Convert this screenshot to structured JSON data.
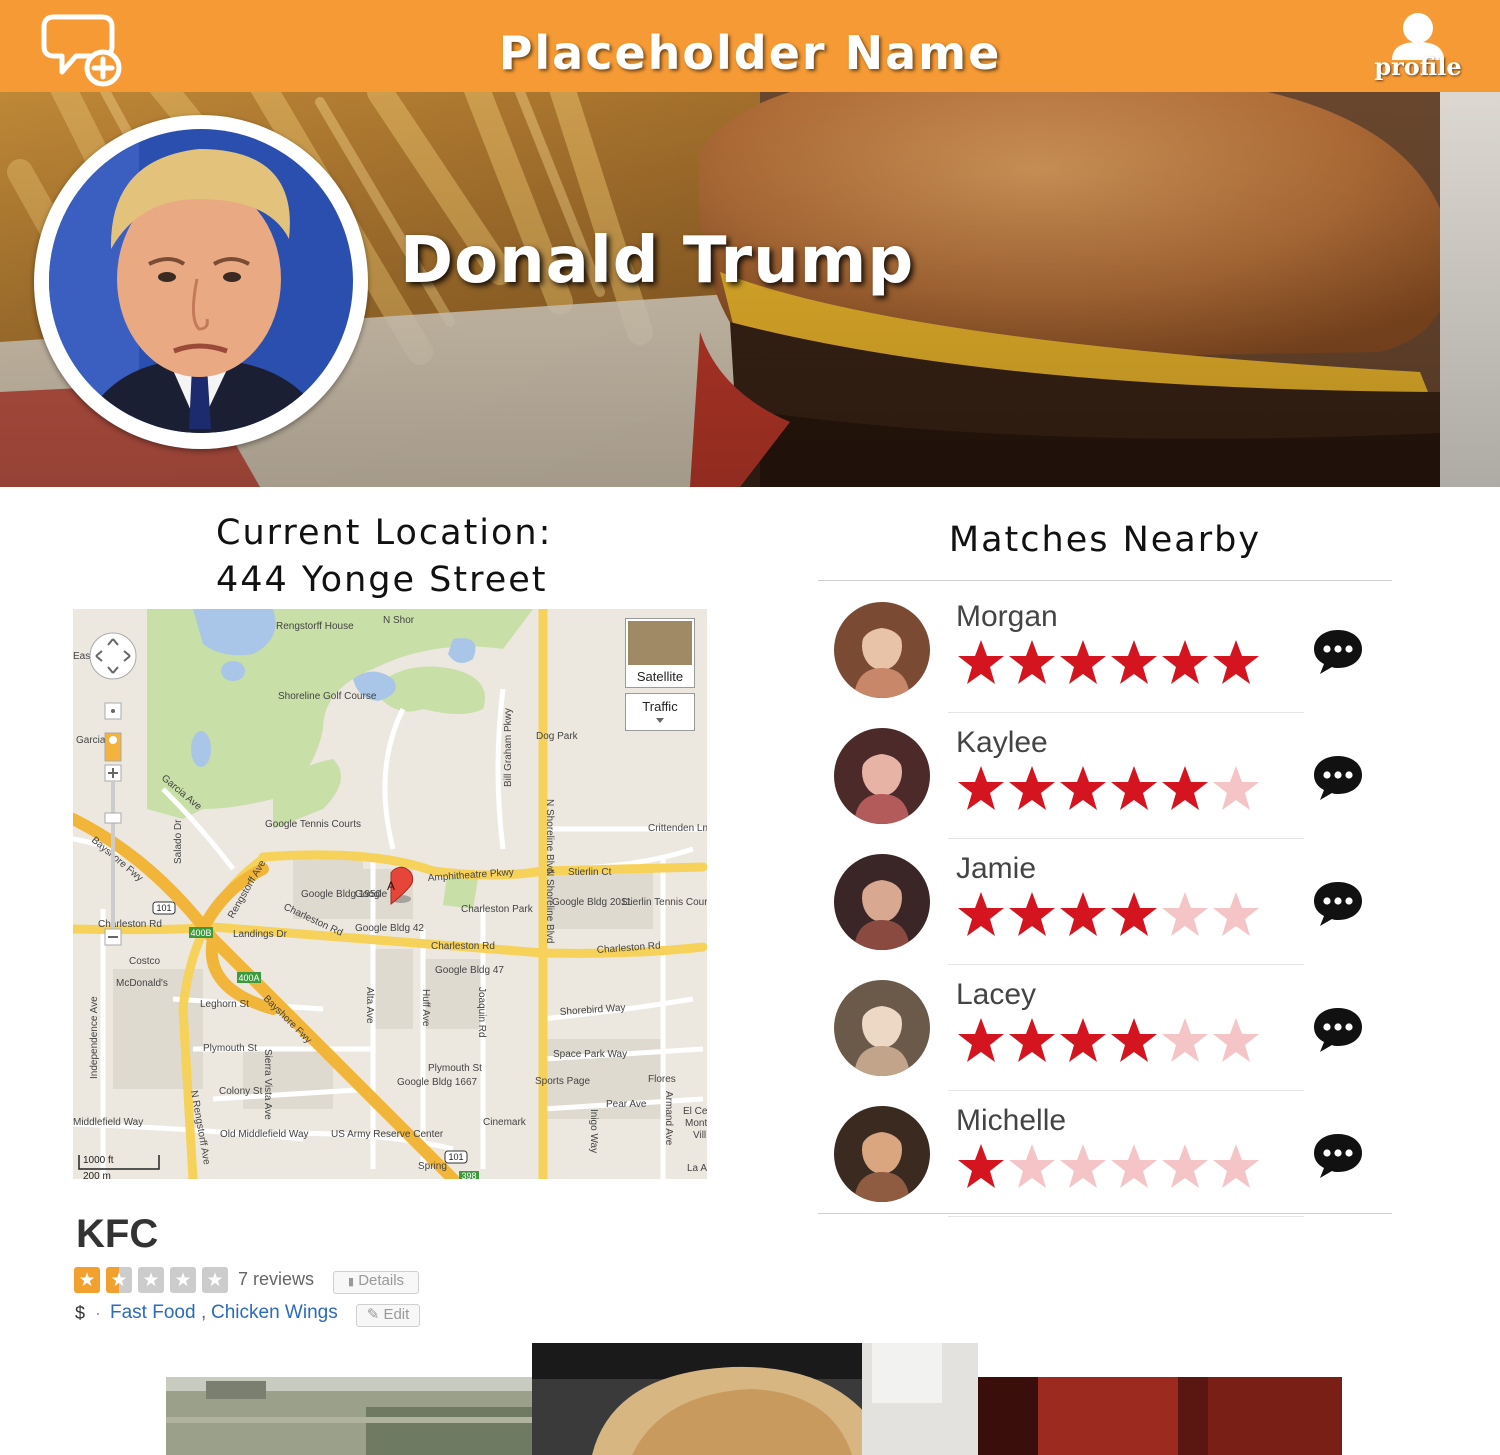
{
  "header": {
    "title": "Placeholder Name",
    "profile_label": "profile",
    "bg_color": "#f59a34",
    "left_icon": "chat-add-icon",
    "right_icon": "user-icon"
  },
  "hero": {
    "name": "Donald Trump",
    "background": "burger-and-fries-photo"
  },
  "location": {
    "title_line1": "Current Location:",
    "title_line2": "444 Yonge Street"
  },
  "map": {
    "satellite_label": "Satellite",
    "traffic_label": "Traffic",
    "scale_label": "1000 ft",
    "scale_label2": "200 m",
    "marker": "A",
    "labels": {
      "rengstorff_house": "Rengstorff House",
      "shoreline_golf": "Shoreline Golf Course",
      "dog_park": "Dog Park",
      "garcia": "Garcia",
      "garcia_ave": "Garcia Ave",
      "google_tennis": "Google Tennis Courts",
      "crittenden": "Crittenden Ln",
      "bayshore_fwy": "Bayshore Fwy",
      "amphitheatre": "Amphitheatre Pkwy",
      "stierlin_ct": "Stierlin Ct",
      "google_1950": "Google Bldg 1950",
      "google_main": "Google",
      "charleston_park": "Charleston Park",
      "google_2011": "Google Bldg 2011",
      "stierlin_tennis": "Stierlin Tennis Court",
      "charleston_rd": "Charleston Rd",
      "landings_dr": "Landings Dr",
      "google_42": "Google Bldg 42",
      "costco": "Costco",
      "mcdonalds": "McDonald's",
      "google_47": "Google Bldg 47",
      "shorebird": "Shorebird Way",
      "leghorn": "Leghorn St",
      "plymouth": "Plymouth St",
      "space_park": "Space Park Way",
      "colony": "Colony St",
      "google_1667": "Google Bldg 1667",
      "sports_page": "Sports Page",
      "flores": "Flores",
      "pear_ave": "Pear Ave",
      "middlefield": "Middlefield Way",
      "old_middlefield": "Old Middlefield Way",
      "us_army": "US Army Reserve Center",
      "cinemark": "Cinemark",
      "n_shoreline": "N Shoreline Blvd",
      "rengstorff_ave": "Rengstorff Ave",
      "salado": "Salado Dr",
      "independence": "Independence Ave",
      "sierra_vista": "Sierra Vista Ave",
      "alta_ave": "Alta Ave",
      "huff_ave": "Huff Ave",
      "joaquin": "Joaquin Rd",
      "bill_graham": "Bill Graham Pkwy",
      "n_rengstorff": "N Rengstorff Ave",
      "armand": "Armand Ave",
      "inigo": "Inigo Way",
      "el_ce": "El Ce",
      "monte": "Monte",
      "vill": "Vill",
      "la_a": "La A",
      "spring": "Spring",
      "hwy_101": "101",
      "exit_400b": "400B",
      "exit_400a": "400A",
      "exit_398": "398",
      "charleston_rd_left": "Charleston Rd",
      "east": "East",
      "n_shore_top": "N Shor"
    }
  },
  "business": {
    "name": "KFC",
    "rating": 1.5,
    "rating_max": 5,
    "reviews": "7 reviews",
    "details_label": "Details",
    "price": "$",
    "separator": "·",
    "categories": [
      "Fast Food",
      "Chicken Wings"
    ],
    "edit_label": "Edit",
    "star_color": "#f3a12e"
  },
  "matches": {
    "title": "Matches Nearby",
    "star_on_color": "#d4141e",
    "star_off_color": "#f4c4c6",
    "chat_icon": "speech-bubble-icon",
    "items": [
      {
        "name": "Morgan",
        "rating": 6,
        "max": 6
      },
      {
        "name": "Kaylee",
        "rating": 5,
        "max": 6
      },
      {
        "name": "Jamie",
        "rating": 4,
        "max": 6
      },
      {
        "name": "Lacey",
        "rating": 4,
        "max": 6
      },
      {
        "name": "Michelle",
        "rating": 1,
        "max": 6
      }
    ]
  }
}
